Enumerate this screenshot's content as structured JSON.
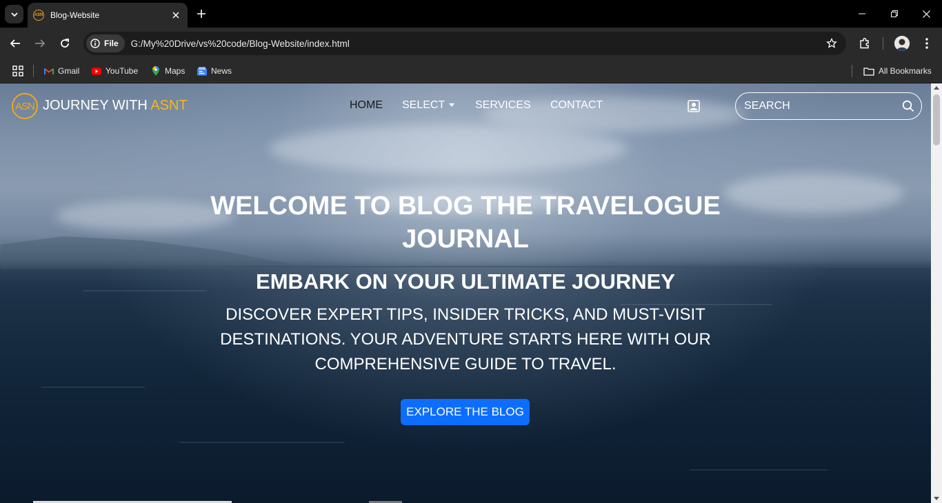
{
  "browser": {
    "tab_title": "Blog-Website",
    "favicon_text": "ASN",
    "site_chip": "File",
    "url": "G:/My%20Drive/vs%20code/Blog-Website/index.html",
    "bookmarks": [
      {
        "label": "Gmail",
        "icon": "gmail-icon"
      },
      {
        "label": "YouTube",
        "icon": "youtube-icon"
      },
      {
        "label": "Maps",
        "icon": "maps-icon"
      },
      {
        "label": "News",
        "icon": "news-icon"
      }
    ],
    "all_bookmarks": "All Bookmarks"
  },
  "site": {
    "logo_text": "ASN",
    "brand_main": "JOURNEY WITH ",
    "brand_accent": "ASNT",
    "accent_color": "#f5b81c",
    "nav": {
      "home": "HOME",
      "select": "SELECT",
      "services": "SERVICES",
      "contact": "CONTACT"
    },
    "search_placeholder": "SEARCH"
  },
  "hero": {
    "title_line1": "WELCOME TO BLOG THE TRAVELOGUE",
    "title_line2": "JOURNAL",
    "subtitle": "EMBARK ON YOUR ULTIMATE JOURNEY",
    "text_line1": "DISCOVER EXPERT TIPS, INSIDER TRICKS, AND MUST-VISIT",
    "text_line2": "DESTINATIONS. YOUR ADVENTURE STARTS HERE WITH OUR",
    "text_line3": "COMPREHENSIVE GUIDE TO TRAVEL.",
    "cta_label": "EXPLORE THE BLOG",
    "cta_color": "#0d6efd"
  }
}
